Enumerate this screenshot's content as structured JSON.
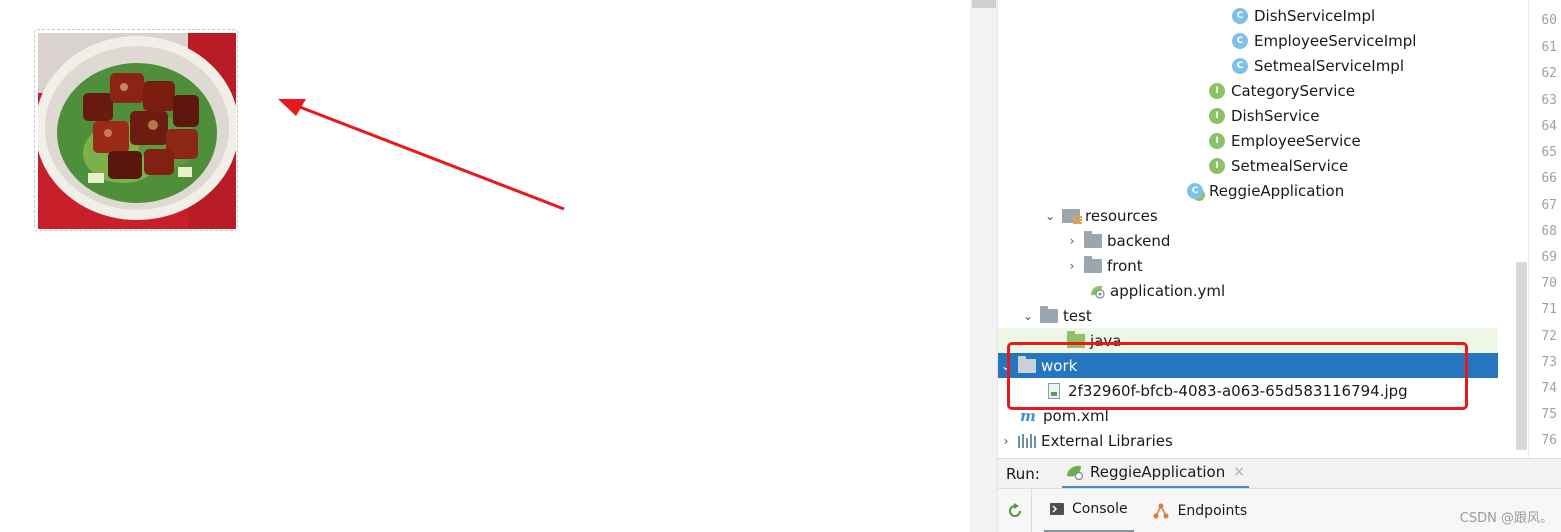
{
  "tree": {
    "items": [
      {
        "label": "DishServiceImpl",
        "icon": "class-icon",
        "kind": "class"
      },
      {
        "label": "EmployeeServiceImpl",
        "icon": "class-icon",
        "kind": "class"
      },
      {
        "label": "SetmealServiceImpl",
        "icon": "class-icon",
        "kind": "class"
      },
      {
        "label": "CategoryService",
        "icon": "interface-icon",
        "kind": "interface"
      },
      {
        "label": "DishService",
        "icon": "interface-icon",
        "kind": "interface"
      },
      {
        "label": "EmployeeService",
        "icon": "interface-icon",
        "kind": "interface"
      },
      {
        "label": "SetmealService",
        "icon": "interface-icon",
        "kind": "interface"
      },
      {
        "label": "ReggieApplication",
        "icon": "spring-boot-class-icon",
        "kind": "main-class"
      },
      {
        "label": "resources",
        "icon": "resources-folder-icon",
        "kind": "folder",
        "expanded": true
      },
      {
        "label": "backend",
        "icon": "folder-icon",
        "kind": "folder",
        "expanded": false
      },
      {
        "label": "front",
        "icon": "folder-icon",
        "kind": "folder",
        "expanded": false
      },
      {
        "label": "application.yml",
        "icon": "yml-file-icon",
        "kind": "file"
      },
      {
        "label": "test",
        "icon": "folder-icon",
        "kind": "folder",
        "expanded": true
      },
      {
        "label": "java",
        "icon": "test-folder-icon",
        "kind": "folder"
      },
      {
        "label": "work",
        "icon": "folder-icon",
        "kind": "folder",
        "expanded": true,
        "selected": true
      },
      {
        "label": "2f32960f-bfcb-4083-a063-65d583116794.jpg",
        "icon": "image-file-icon",
        "kind": "file"
      },
      {
        "label": "pom.xml",
        "icon": "maven-icon",
        "kind": "file"
      },
      {
        "label": "External Libraries",
        "icon": "libraries-icon",
        "kind": "folder",
        "expanded": false
      }
    ]
  },
  "gutter": {
    "line_numbers": [
      "60",
      "61",
      "62",
      "63",
      "64",
      "65",
      "66",
      "67",
      "68",
      "69",
      "70",
      "71",
      "72",
      "73",
      "74",
      "75",
      "76"
    ]
  },
  "run_window": {
    "label": "Run:",
    "tab_label": "ReggieApplication",
    "close_glyph": "×",
    "console_label": "Console",
    "endpoints_label": "Endpoints"
  },
  "watermark": "CSDN @跟风。",
  "colors": {
    "selection": "#2675bf",
    "highlight_box": "#e8191c",
    "arrow": "#e8191c"
  }
}
